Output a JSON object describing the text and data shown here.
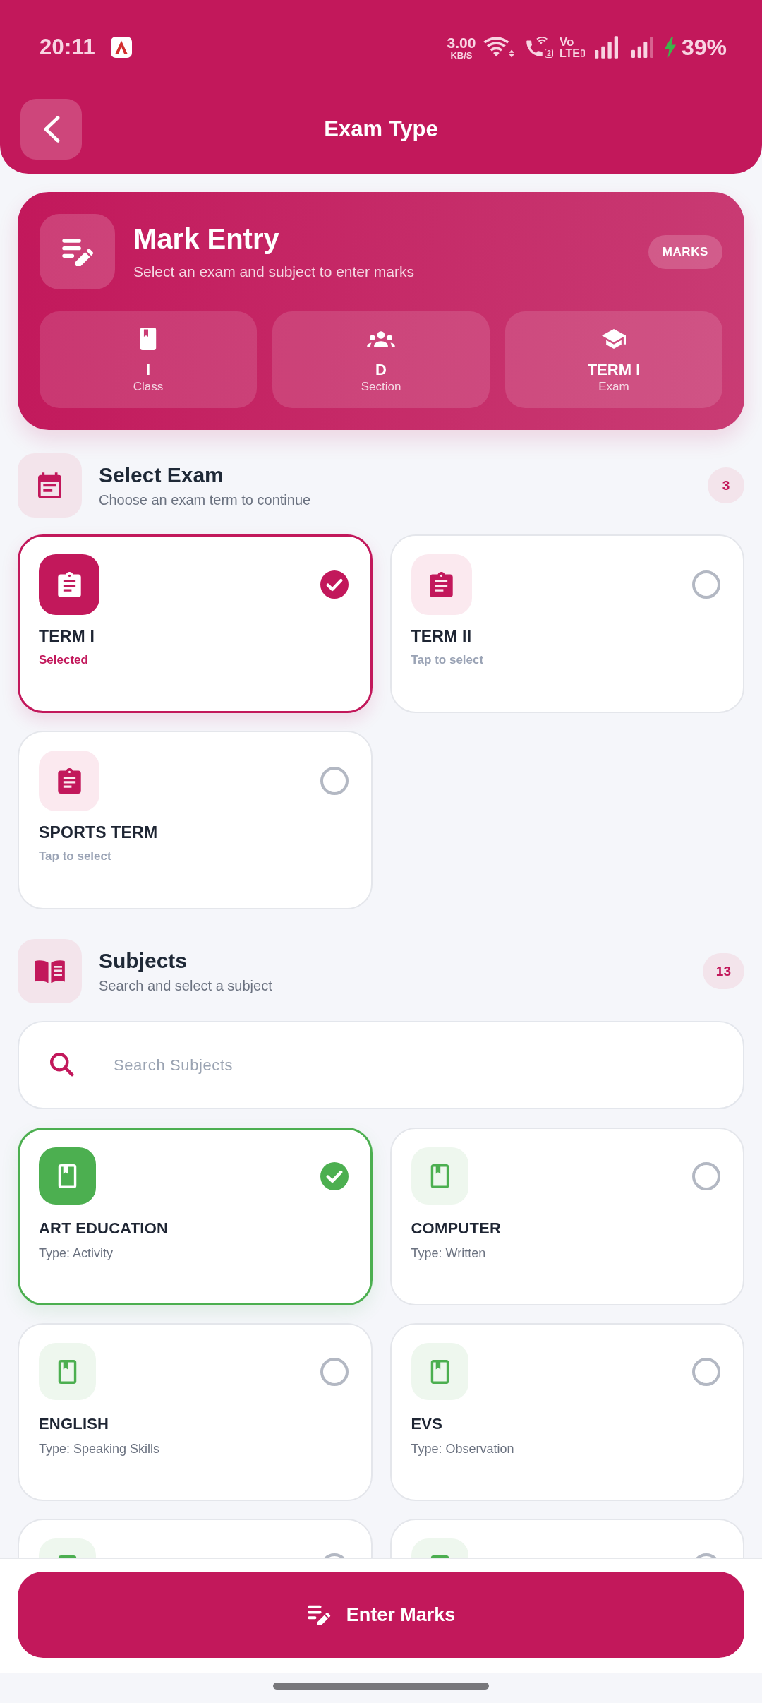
{
  "status_bar": {
    "time": "20:11",
    "net_speed": "3.00",
    "net_unit": "KB/S",
    "call_sim": "2",
    "volte_top": "Vo",
    "volte_bottom": "LTE",
    "charging": true,
    "battery": "39%"
  },
  "header": {
    "title": "Exam Type"
  },
  "summary_card": {
    "title": "Mark Entry",
    "subtitle": "Select an exam and subject to enter marks",
    "tag": "MARKS",
    "stats": [
      {
        "kind": "class",
        "value": "I",
        "label": "Class"
      },
      {
        "kind": "section",
        "value": "D",
        "label": "Section"
      },
      {
        "kind": "exam",
        "value": "TERM I",
        "label": "Exam"
      }
    ]
  },
  "exam_section": {
    "title": "Select Exam",
    "subtitle": "Choose an exam term to continue",
    "count": "3",
    "exams": [
      {
        "name": "TERM I",
        "status": "Selected",
        "selected": true
      },
      {
        "name": "TERM II",
        "status": "Tap to select",
        "selected": false
      },
      {
        "name": "SPORTS TERM",
        "status": "Tap to select",
        "selected": false
      }
    ]
  },
  "subject_section": {
    "title": "Subjects",
    "subtitle": "Search and select a subject",
    "count": "13",
    "search": {
      "placeholder": "Search Subjects"
    },
    "subjects": [
      {
        "name": "ART EDUCATION",
        "type": "Type: Activity",
        "selected": true
      },
      {
        "name": "COMPUTER",
        "type": "Type: Written",
        "selected": false
      },
      {
        "name": "ENGLISH",
        "type": "Type: Speaking Skills",
        "selected": false
      },
      {
        "name": "EVS",
        "type": "Type: Observation",
        "selected": false
      },
      {
        "selected": false
      },
      {
        "selected": false
      }
    ]
  },
  "action_button": {
    "label": "Enter Marks"
  }
}
